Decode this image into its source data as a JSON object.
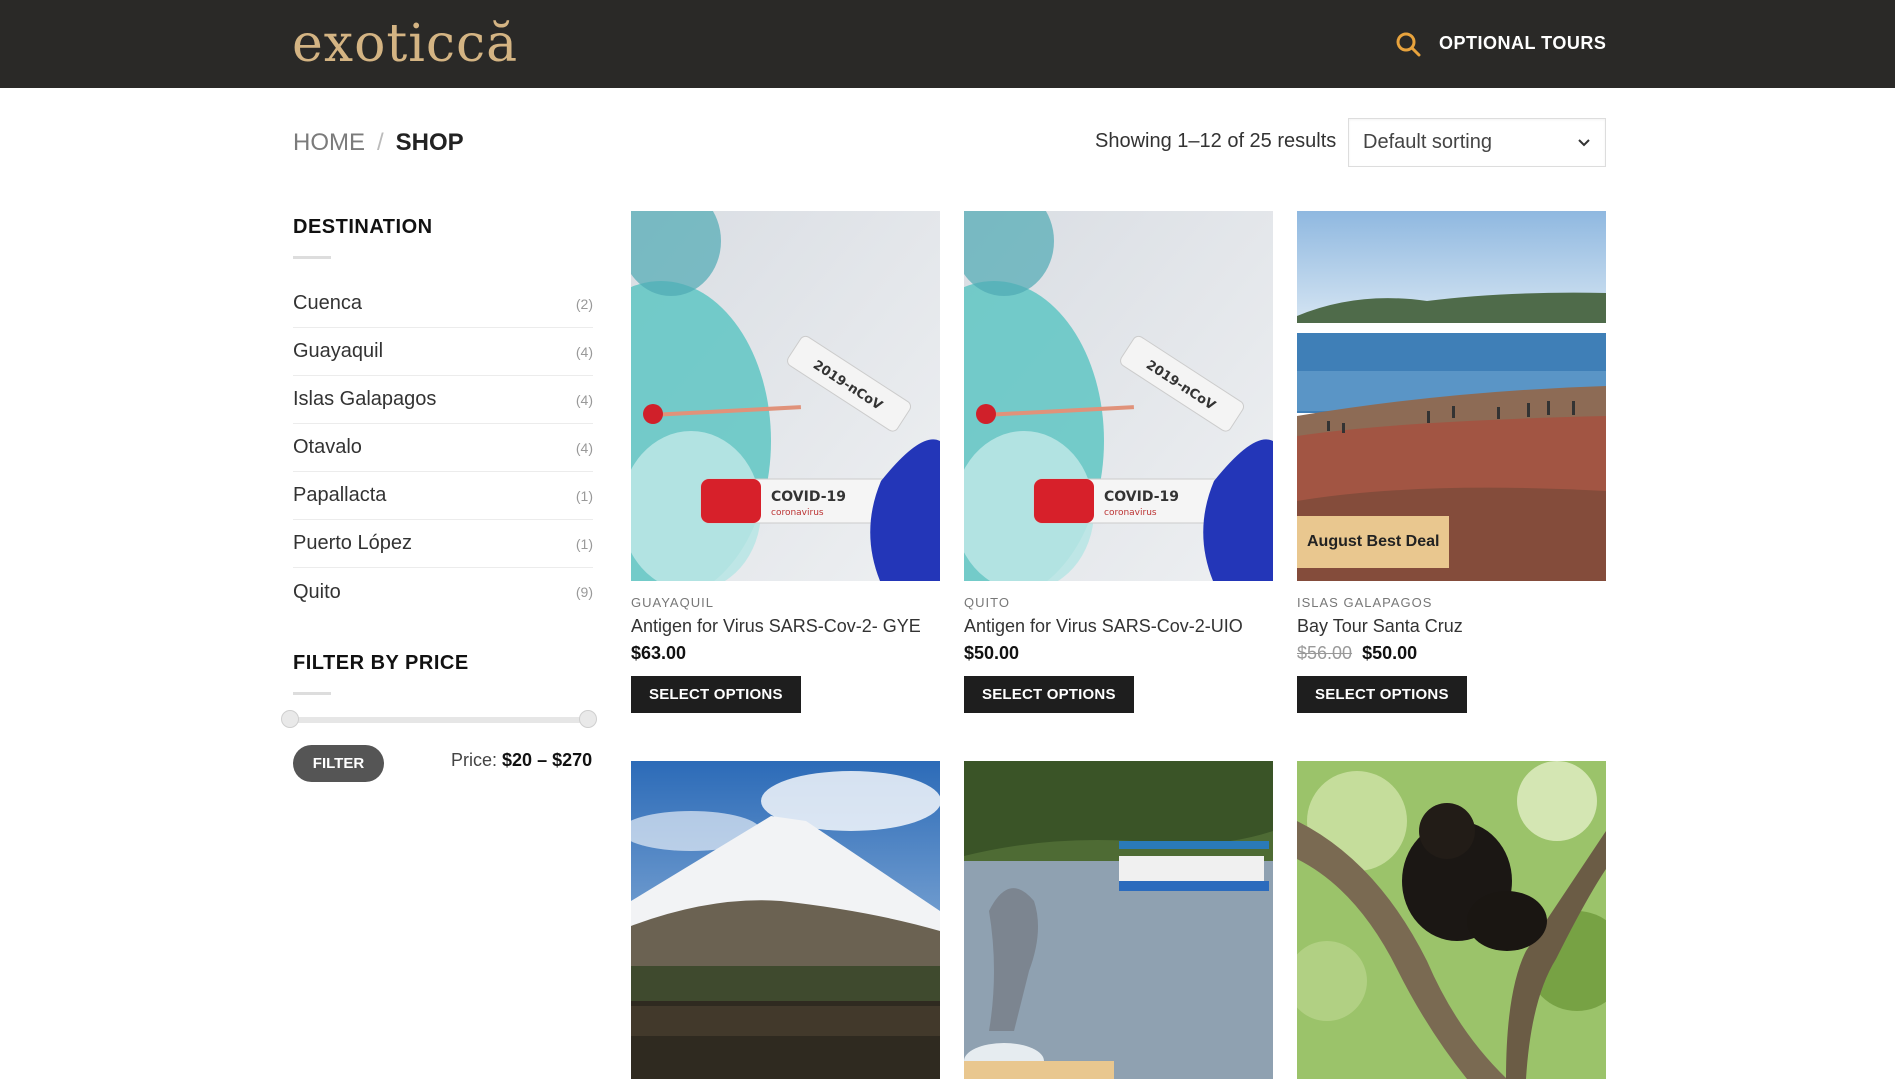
{
  "header": {
    "logo": "exoticcă",
    "search_icon": "search-icon",
    "nav_link": "OPTIONAL TOURS"
  },
  "breadcrumb": {
    "home": "HOME",
    "separator": "/",
    "current": "SHOP"
  },
  "results": {
    "count_text": "Showing 1–12 of 25 results",
    "sort_selected": "Default sorting"
  },
  "sidebar": {
    "destination_title": "DESTINATION",
    "destinations": [
      {
        "name": "Cuenca",
        "count": "(2)"
      },
      {
        "name": "Guayaquil",
        "count": "(4)"
      },
      {
        "name": "Islas Galapagos",
        "count": "(4)"
      },
      {
        "name": "Otavalo",
        "count": "(4)"
      },
      {
        "name": "Papallacta",
        "count": "(1)"
      },
      {
        "name": "Puerto López",
        "count": "(1)"
      },
      {
        "name": "Quito",
        "count": "(9)"
      }
    ],
    "price_title": "FILTER BY PRICE",
    "filter_button": "FILTER",
    "price_prefix": "Price:",
    "price_min": "$20",
    "price_dash": "–",
    "price_max": "$270"
  },
  "products": [
    {
      "category": "GUAYAQUIL",
      "title": "Antigen for Virus SARS-Cov-2- GYE",
      "price": "$63.00",
      "button": "SELECT OPTIONS",
      "image": "covid-test"
    },
    {
      "category": "QUITO",
      "title": "Antigen for Virus SARS-Cov-2-UIO",
      "price": "$50.00",
      "button": "SELECT OPTIONS",
      "image": "covid-test"
    },
    {
      "category": "ISLAS GALAPAGOS",
      "title": "Bay Tour Santa Cruz",
      "old_price": "$56.00",
      "price": "$50.00",
      "button": "SELECT OPTIONS",
      "badge": "August Best Deal",
      "image": "galapagos-coast"
    },
    {
      "image": "cotopaxi-volcano"
    },
    {
      "image": "dolphin-river"
    },
    {
      "image": "howler-monkey"
    }
  ],
  "covid_tube_label": "COVID-19",
  "covid_tube_sublabel": "coronavirus",
  "covid_tube2_label": "2019-nCoV",
  "colors": {
    "header_bg": "#2a2927",
    "logo_gold": "#d4b483",
    "badge": "#e9c78f",
    "button": "#1e1e1e"
  }
}
